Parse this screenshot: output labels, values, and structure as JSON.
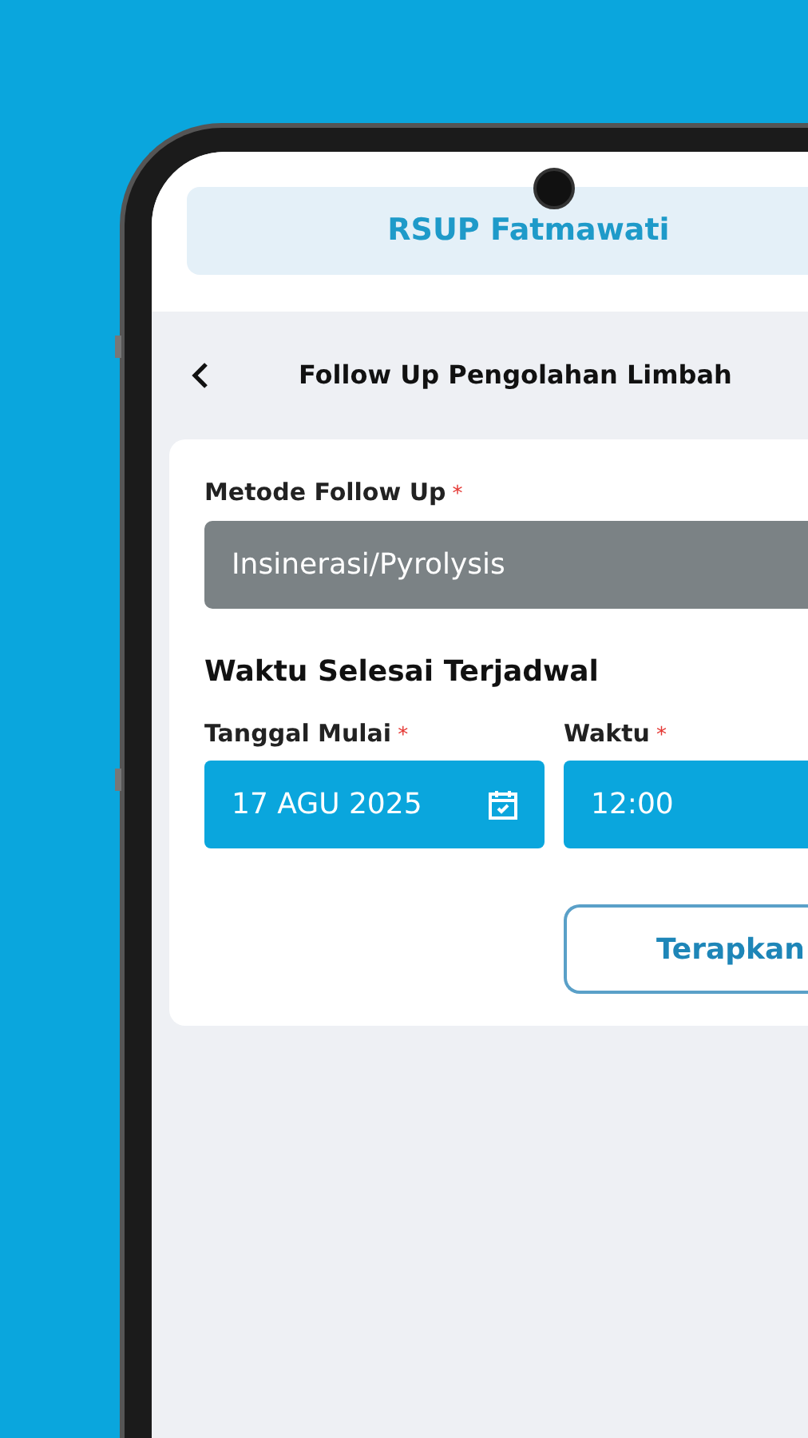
{
  "header": {
    "title": "RSUP Fatmawati"
  },
  "page": {
    "title": "Follow Up Pengolahan Limbah"
  },
  "form": {
    "method": {
      "label": "Metode Follow Up",
      "required_mark": "*",
      "value": "Insinerasi/Pyrolysis",
      "disabled": true
    },
    "section_title": "Waktu Selesai Terjadwal",
    "date": {
      "label": "Tanggal Mulai",
      "required_mark": "*",
      "value": "17 AGU 2025"
    },
    "time": {
      "label": "Waktu",
      "required_mark": "*",
      "value": "12:00"
    },
    "apply_button": "Terapkan"
  }
}
